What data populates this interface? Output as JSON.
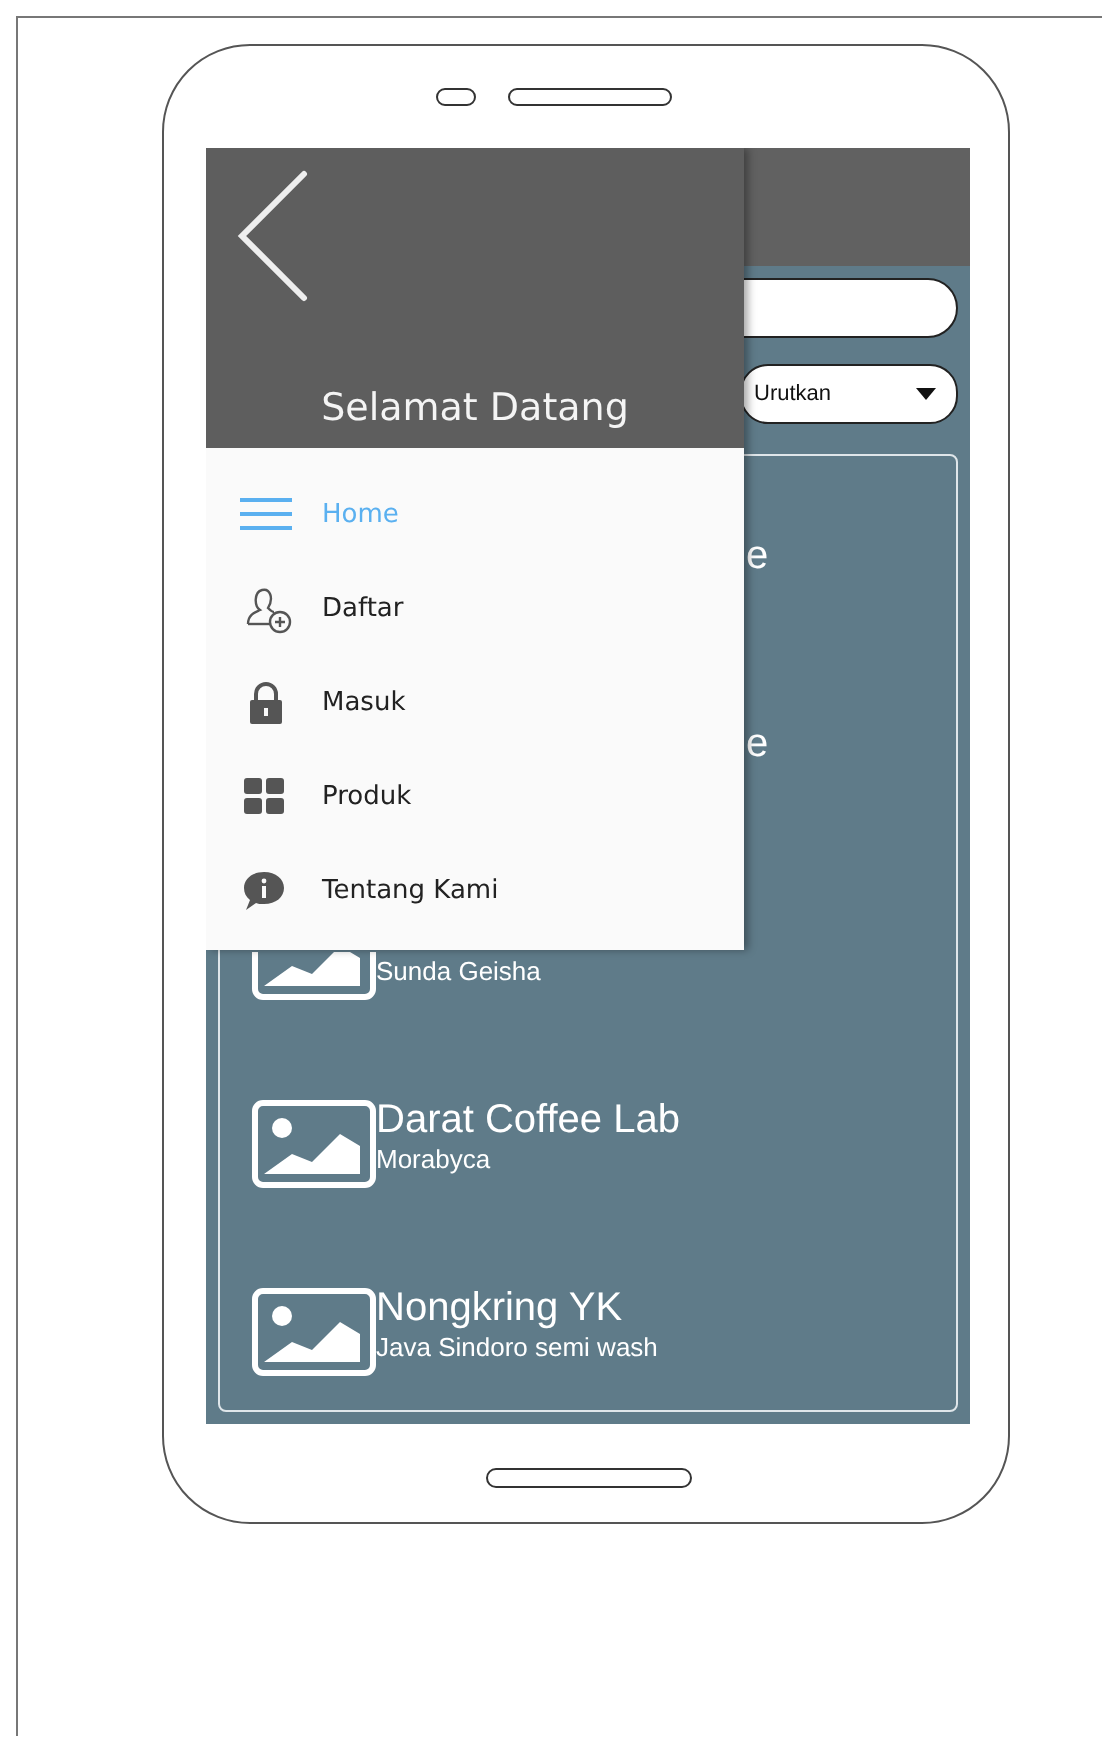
{
  "drawer": {
    "title": "Selamat Datang",
    "items": [
      {
        "kind": "menu",
        "label": "Home",
        "selected": true
      },
      {
        "kind": "user-add",
        "label": "Daftar",
        "selected": false
      },
      {
        "kind": "lock",
        "label": "Masuk",
        "selected": false
      },
      {
        "kind": "grid",
        "label": "Produk",
        "selected": false
      },
      {
        "kind": "info",
        "label": "Tentang Kami",
        "selected": false
      }
    ]
  },
  "sort": {
    "label": "Urutkan"
  },
  "list": [
    {
      "kind": "covered",
      "title": "e"
    },
    {
      "kind": "covered",
      "title": "e"
    },
    {
      "kind": "untitled",
      "subtitle": "Sunda Geisha"
    },
    {
      "kind": "full",
      "title": "Darat Coffee Lab",
      "subtitle": "Morabyca"
    },
    {
      "kind": "full",
      "title": "Nongkring YK",
      "subtitle": "Java Sindoro semi wash"
    }
  ]
}
